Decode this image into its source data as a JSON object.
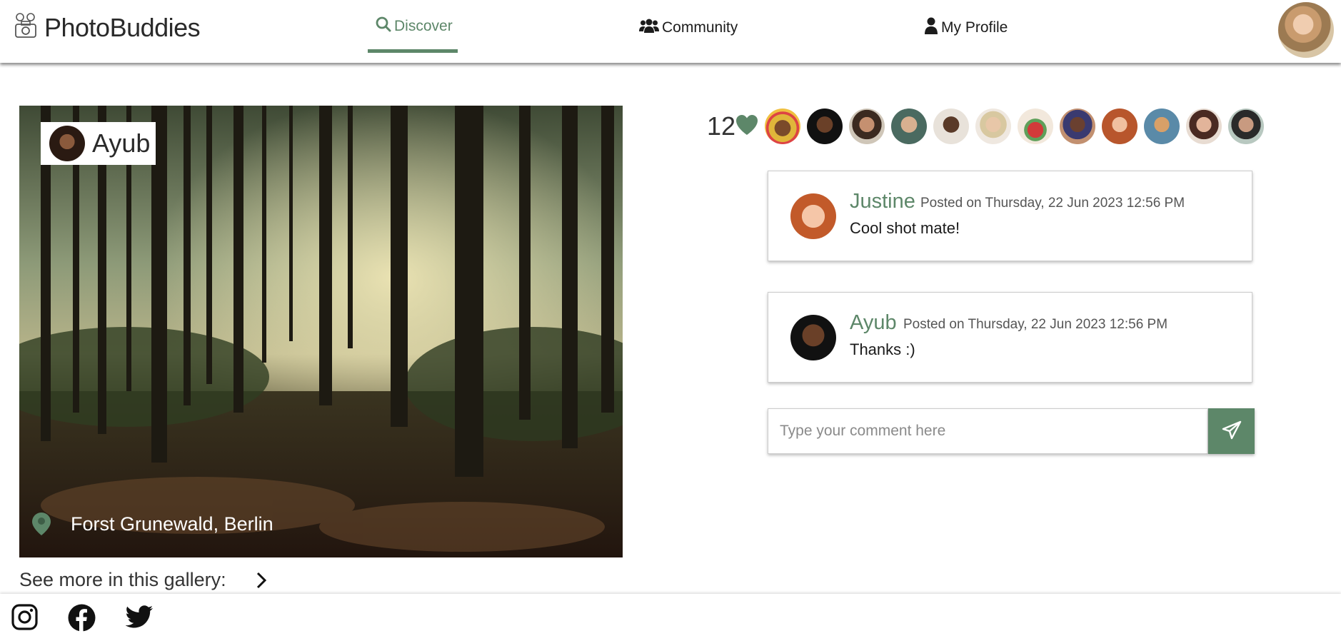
{
  "app": {
    "name": "PhotoBuddies"
  },
  "nav": {
    "discover": "Discover",
    "community": "Community",
    "profile": "My Profile"
  },
  "post": {
    "author": "Ayub",
    "location": "Forst Grunewald, Berlin",
    "see_more": "See more in this gallery:"
  },
  "likes": {
    "count": "12",
    "heart_color": "#5d8769"
  },
  "comments": [
    {
      "name": "Justine",
      "date": "Posted on Thursday, 22 Jun 2023 12:56 PM",
      "text": "Cool shot mate!"
    },
    {
      "name": "Ayub",
      "date": "Posted on Thursday, 22 Jun 2023 12:56 PM",
      "text": "Thanks :)"
    }
  ],
  "comment_form": {
    "placeholder": "Type your comment here"
  },
  "colors": {
    "accent": "#5d8769"
  },
  "icons": [
    "camera-logo-icon",
    "search-icon",
    "users-icon",
    "user-icon",
    "heart-icon",
    "location-pin-icon",
    "chevron-right-icon",
    "send-icon",
    "instagram-icon",
    "facebook-icon",
    "twitter-icon"
  ]
}
